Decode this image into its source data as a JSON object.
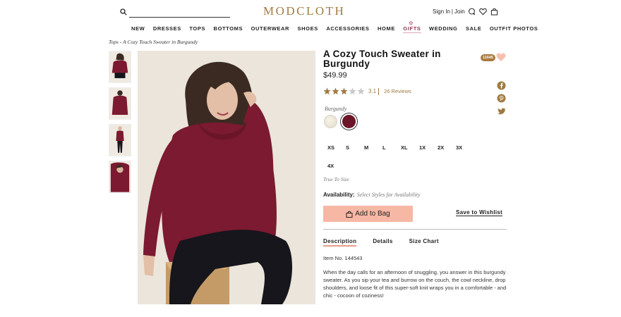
{
  "header": {
    "logo": "MODCLOTH",
    "sign_in": "Sign In",
    "separator": "|",
    "join": "Join",
    "search_placeholder": ""
  },
  "nav": {
    "items": [
      "NEW",
      "DRESSES",
      "TOPS",
      "BOTTOMS",
      "OUTERWEAR",
      "SHOES",
      "ACCESSORIES",
      "HOME",
      "GIFTS",
      "WEDDING",
      "SALE",
      "OUTFIT PHOTOS"
    ]
  },
  "breadcrumb": "Tops - A Cozy Touch Sweater in Burgundy",
  "product": {
    "title": "A Cozy Touch Sweater in Burgundy",
    "price": "$49.99",
    "favorites_count": "11645",
    "rating": 3.1,
    "rating_text": "3.1",
    "reviews": "26 Reviews",
    "color_label": "Burgundy",
    "sizes": [
      "XS",
      "S",
      "M",
      "L",
      "XL",
      "1X",
      "2X",
      "3X",
      "4X"
    ],
    "fit": "True To Size",
    "availability_label": "Availability:",
    "availability_value": "Select Styles for Availability",
    "add_to_bag": "Add to Bag",
    "save_to_wishlist": "Save to Wishlist",
    "tabs": [
      "Description",
      "Details",
      "Size Chart"
    ],
    "item_no": "Item No. 144543",
    "description": "When the day calls for an afternoon of snuggling, you answer in this burgundy sweater. As you sip your tea and burrow on the couch, the cowl neckline, drop shoulders, and loose fit of this super-soft knit wraps you in a comfortable - and chic - cocoon of coziness!"
  },
  "colors": {
    "brand_gold": "#a07a43",
    "accent_pink": "#f7b7a5",
    "burgundy": "#6e1428"
  }
}
